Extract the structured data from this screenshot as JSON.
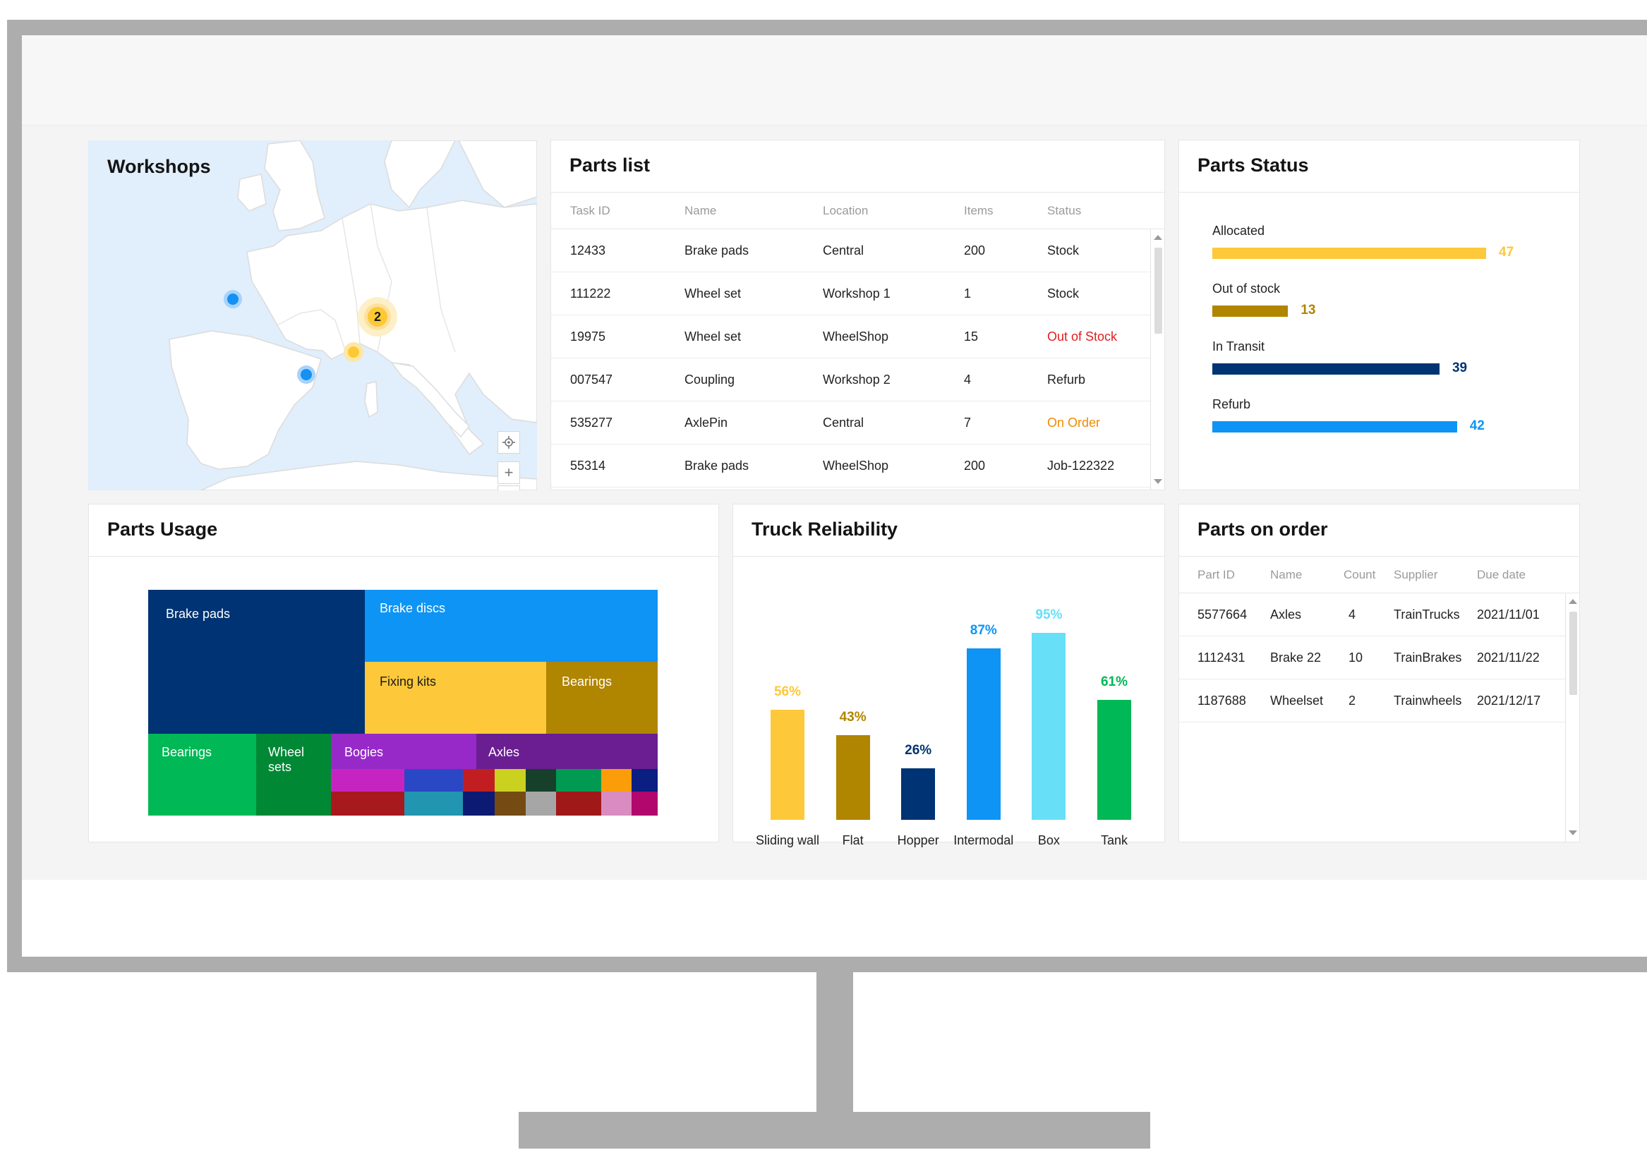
{
  "workshops": {
    "title": "Workshops",
    "cluster_count": "2",
    "controls": {
      "locate_icon": "crosshair-icon",
      "zoom_in": "+",
      "zoom_out": "−"
    }
  },
  "parts_list": {
    "title": "Parts list",
    "columns": [
      "Task ID",
      "Name",
      "Location",
      "Items",
      "Status"
    ],
    "rows": [
      {
        "task_id": "12433",
        "name": "Brake pads",
        "location": "Central",
        "items": "200",
        "status": "Stock"
      },
      {
        "task_id": "111222",
        "name": "Wheel set",
        "location": "Workshop 1",
        "items": "1",
        "status": "Stock"
      },
      {
        "task_id": "19975",
        "name": "Wheel set",
        "location": "WheelShop",
        "items": "15",
        "status": "Out of Stock"
      },
      {
        "task_id": "007547",
        "name": "Coupling",
        "location": "Workshop 2",
        "items": "4",
        "status": "Refurb"
      },
      {
        "task_id": "535277",
        "name": "AxlePin",
        "location": "Central",
        "items": "7",
        "status": "On Order"
      },
      {
        "task_id": "55314",
        "name": "Brake pads",
        "location": "WheelShop",
        "items": "200",
        "status": "Job-122322"
      }
    ],
    "status_colors": {
      "Out of Stock": "#e01e1e",
      "On Order": "#f08a00"
    }
  },
  "parts_status": {
    "title": "Parts Status",
    "items": [
      {
        "label": "Allocated",
        "value": "47",
        "color": "#fdc93a"
      },
      {
        "label": "Out of stock",
        "value": "13",
        "color": "#b08500"
      },
      {
        "label": "In Transit",
        "value": "39",
        "color": "#003373"
      },
      {
        "label": "Refurb",
        "value": "42",
        "color": "#0d94f5"
      }
    ]
  },
  "parts_usage": {
    "title": "Parts Usage",
    "labels": {
      "brake_pads": "Brake pads",
      "brake_discs": "Brake discs",
      "fixing_kits": "Fixing kits",
      "bearings_small": "Bearings",
      "bearings": "Bearings",
      "wheel_sets_1": "Wheel",
      "wheel_sets_2": "sets",
      "bogies": "Bogies",
      "axles": "Axles"
    }
  },
  "truck_reliability": {
    "title": "Truck Reliability"
  },
  "chart_data": {
    "type": "bar",
    "title": "Truck Reliability",
    "categories": [
      "Sliding wall",
      "Flat",
      "Hopper",
      "Intermodal",
      "Box",
      "Tank"
    ],
    "values": [
      56,
      43,
      26,
      87,
      95,
      61
    ],
    "value_labels": [
      "56%",
      "43%",
      "26%",
      "87%",
      "95%",
      "61%"
    ],
    "colors": [
      "#fdc93a",
      "#b08500",
      "#003373",
      "#0d94f5",
      "#66dff7",
      "#00b855"
    ],
    "ylim": [
      0,
      100
    ],
    "grid": false,
    "xlabel": "",
    "ylabel": ""
  },
  "parts_on_order": {
    "title": "Parts on order",
    "columns": [
      "Part ID",
      "Name",
      "Count",
      "Supplier",
      "Due date"
    ],
    "rows": [
      {
        "part_id": "5577664",
        "name": "Axles",
        "count": "4",
        "supplier": "TrainTrucks",
        "due": "2021/11/01"
      },
      {
        "part_id": "1112431",
        "name": "Brake 22",
        "count": "10",
        "supplier": "TrainBrakes",
        "due": "2021/11/22"
      },
      {
        "part_id": "1187688",
        "name": "Wheelset",
        "count": "2",
        "supplier": "Trainwheels",
        "due": "2021/12/17"
      }
    ]
  }
}
